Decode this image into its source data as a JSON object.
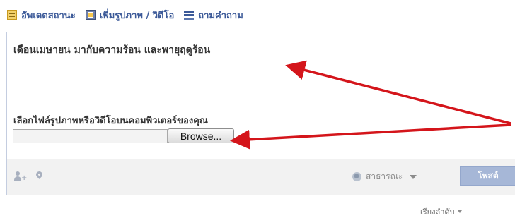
{
  "tabs": [
    {
      "label": "อัพเดตสถานะ",
      "icon": "status-icon"
    },
    {
      "label": "เพิ่มรูปภาพ / วิดีโอ",
      "icon": "photo-icon"
    },
    {
      "label": "ถามคำถาม",
      "icon": "question-icon"
    }
  ],
  "composer": {
    "status_text": "เดือนเมษายน มากับความร้อน และพายุฤดูร้อน",
    "file_label": "เลือกไฟล์รูปภาพหรือวิดีโอบนคอมพิวเตอร์ของคุณ",
    "file_value": "",
    "browse_label": "Browse...",
    "audience_label": "สาธารณะ",
    "post_label": "โพสต์"
  },
  "sort": {
    "label": "เรียงลำดับ"
  },
  "colors": {
    "link_blue": "#3b5998",
    "annotation_red": "#d4151b",
    "post_button": "#a6b7d7"
  }
}
